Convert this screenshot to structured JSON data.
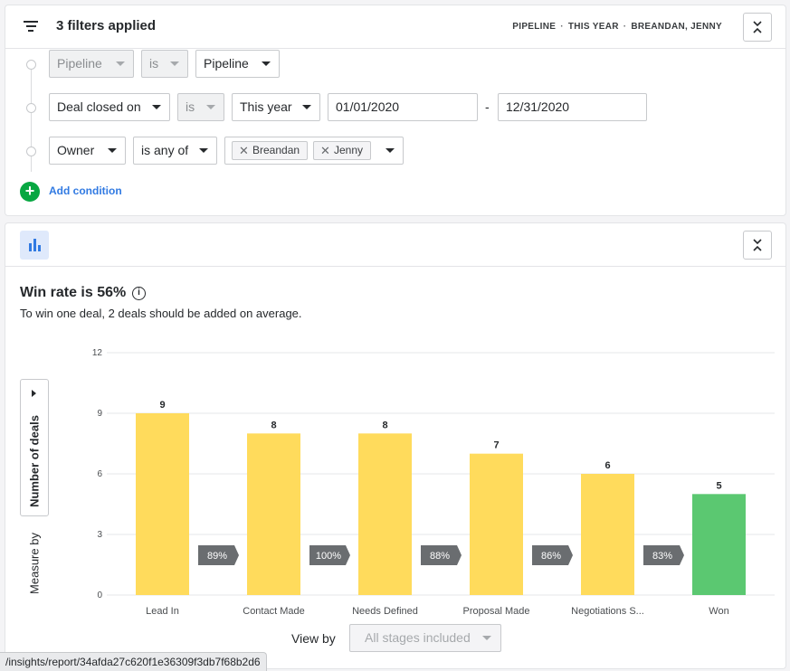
{
  "filters": {
    "title": "3 filters applied",
    "summary": [
      "PIPELINE",
      "THIS YEAR",
      "BREANDAN, JENNY"
    ],
    "separator": "·",
    "rows": [
      {
        "field": "Pipeline",
        "operator": "is",
        "value": "Pipeline"
      },
      {
        "field": "Deal closed on",
        "operator": "is",
        "value": "This year",
        "from": "01/01/2020",
        "to": "12/31/2020",
        "range_sep": "-"
      },
      {
        "field": "Owner",
        "operator": "is any of",
        "chips": [
          "Breandan",
          "Jenny"
        ]
      }
    ],
    "add_condition": "Add condition"
  },
  "report": {
    "title": "Win rate is 56%",
    "info_glyph": "i",
    "subtitle": "To win one deal, 2 deals should be added on average.",
    "measure_value": "Number of deals",
    "measure_label": "Measure by",
    "view_by_label": "View by",
    "view_by_value": "All stages included"
  },
  "chart_data": {
    "type": "bar",
    "categories": [
      "Lead In",
      "Contact Made",
      "Needs Defined",
      "Proposal Made",
      "Negotiations S...",
      "Won"
    ],
    "values": [
      9,
      8,
      8,
      7,
      6,
      5
    ],
    "conversion": [
      "89%",
      "100%",
      "88%",
      "86%",
      "83%"
    ],
    "yticks": [
      0,
      3,
      6,
      9,
      12
    ],
    "ylim": [
      0,
      12
    ],
    "grid": true,
    "bar_color": "#ffdb5c",
    "won_color": "#5bc871",
    "conversion_color": "#6a6d70"
  },
  "status_url": "/insights/report/34afda27c620f1e36309f3db7f68b2d6"
}
